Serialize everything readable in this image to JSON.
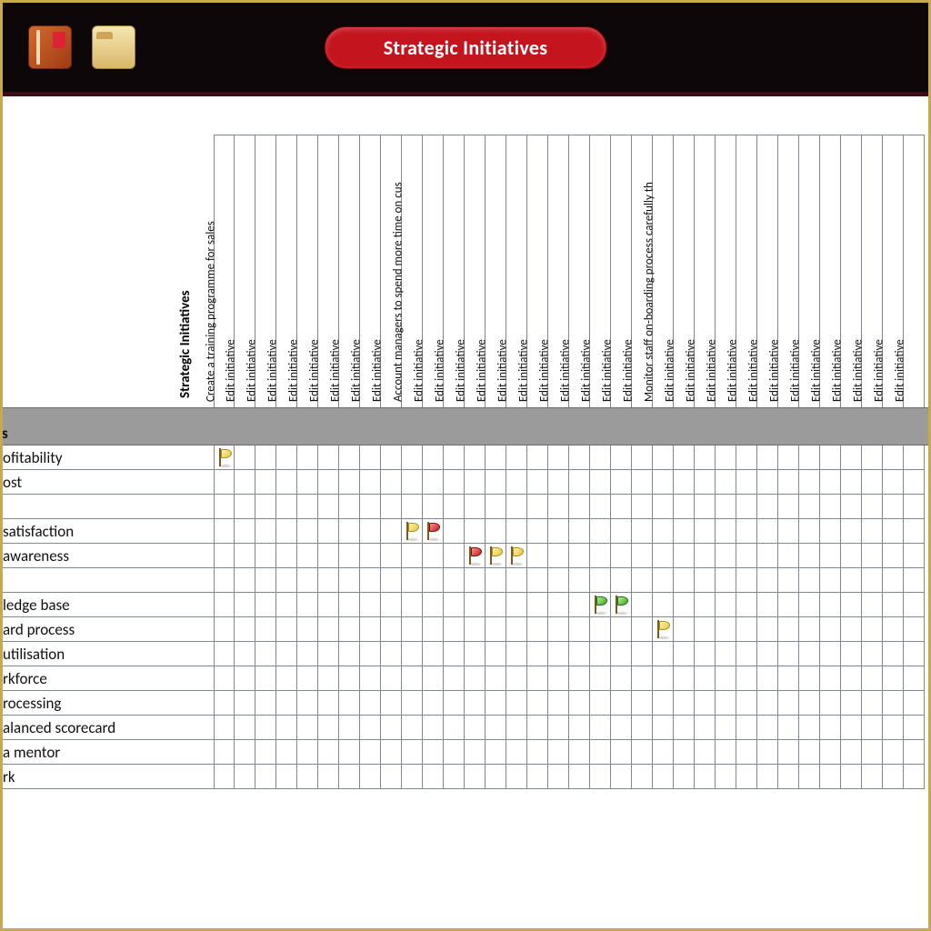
{
  "header": {
    "title": "Strategic Initiatives",
    "icons": [
      {
        "name": "book-icon"
      },
      {
        "name": "folder-icon"
      }
    ]
  },
  "matrix": {
    "corner_label": "Strategic Initiatives",
    "columns": [
      "Create a training programme for sales",
      "Edit initiative",
      "Edit initiative",
      "Edit initiative",
      "Edit initiative",
      "Edit initiative",
      "Edit initiative",
      "Edit initiative",
      "Edit initiative",
      "Account managers to spend more time on cus",
      "Edit initiative",
      "Edit initiative",
      "Edit initiative",
      "Edit initiative",
      "Edit initiative",
      "Edit initiative",
      "Edit initiative",
      "Edit initiative",
      "Edit initiative",
      "Edit initiative",
      "Edit initiative",
      "Monitor staff on-boarding process carefully th",
      "Edit initiative",
      "Edit initiative",
      "Edit initiative",
      "Edit initiative",
      "Edit initiative",
      "Edit initiative",
      "Edit initiative",
      "Edit initiative",
      "Edit initiative",
      "Edit initiative",
      "Edit initiative",
      "Edit initiative"
    ],
    "section_label": "s",
    "rows": [
      {
        "label": "ofitability",
        "flags": [
          {
            "col": 0,
            "color": "yellow"
          }
        ],
        "spacer": false
      },
      {
        "label": "ost",
        "flags": [],
        "spacer": false
      },
      {
        "label": "",
        "flags": [],
        "spacer": true
      },
      {
        "label": "satisfaction",
        "flags": [
          {
            "col": 9,
            "color": "yellow"
          },
          {
            "col": 10,
            "color": "red"
          }
        ],
        "spacer": false
      },
      {
        "label": "awareness",
        "flags": [
          {
            "col": 12,
            "color": "red"
          },
          {
            "col": 13,
            "color": "yellow"
          },
          {
            "col": 14,
            "color": "yellow"
          }
        ],
        "spacer": false
      },
      {
        "label": "",
        "flags": [],
        "spacer": true
      },
      {
        "label": "ledge base",
        "flags": [
          {
            "col": 18,
            "color": "green"
          },
          {
            "col": 19,
            "color": "green"
          }
        ],
        "spacer": false
      },
      {
        "label": "ard process",
        "flags": [
          {
            "col": 21,
            "color": "yellow"
          }
        ],
        "spacer": false
      },
      {
        "label": "utilisation",
        "flags": [],
        "spacer": false
      },
      {
        "label": "rkforce",
        "flags": [],
        "spacer": false
      },
      {
        "label": "rocessing",
        "flags": [],
        "spacer": false
      },
      {
        "label": "alanced scorecard",
        "flags": [],
        "spacer": false
      },
      {
        "label": "a mentor",
        "flags": [],
        "spacer": false
      },
      {
        "label": "rk",
        "flags": [],
        "spacer": false
      }
    ]
  }
}
